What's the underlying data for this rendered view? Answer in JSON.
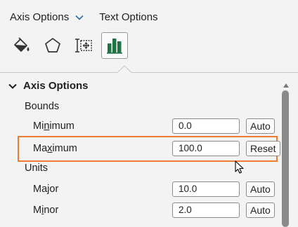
{
  "tabs": {
    "axis_options": "Axis Options",
    "text_options": "Text Options"
  },
  "icons": [
    "fill-line-icon",
    "effects-icon",
    "size-properties-icon",
    "axis-options-icon"
  ],
  "section": {
    "title": "Axis Options"
  },
  "bounds": {
    "label": "Bounds",
    "minimum": {
      "label_a": "Mi",
      "label_u": "n",
      "label_b": "imum",
      "value": "0.0",
      "button": "Auto"
    },
    "maximum": {
      "label_a": "Ma",
      "label_u": "x",
      "label_b": "imum",
      "value": "100.0",
      "button": "Reset"
    }
  },
  "units": {
    "label": "Units",
    "major": {
      "label_a": "Ma",
      "label_u": "j",
      "label_b": "or",
      "value": "10.0",
      "button": "Auto"
    },
    "minor": {
      "label_a": "M",
      "label_u": "i",
      "label_b": "nor",
      "value": "2.0",
      "button": "Auto"
    }
  },
  "colors": {
    "accent": "#ed7d31",
    "chart_green": "#217346",
    "chevron_blue": "#2b6cb0"
  }
}
